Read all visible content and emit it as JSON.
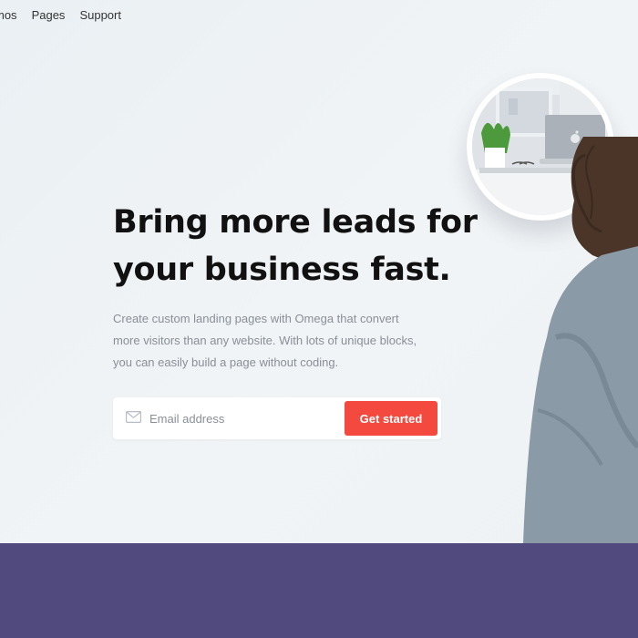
{
  "nav": {
    "items": [
      "mos",
      "Pages",
      "Support"
    ]
  },
  "hero": {
    "headline_line1": "Bring more leads for",
    "headline_line2": "your business fast.",
    "subtext": "Create custom landing pages with Omega that convert more visitors than any website. With lots of unique blocks, you can easily build a page without coding."
  },
  "signup": {
    "email_placeholder": "Email address",
    "cta_label": "Get started"
  },
  "icons": {
    "email": "mail-icon",
    "laptop_logo": "apple-logo-icon"
  },
  "colors": {
    "accent": "#f4493e",
    "band": "#504a7f",
    "heading": "#111111",
    "body_text": "#8a8f98"
  }
}
